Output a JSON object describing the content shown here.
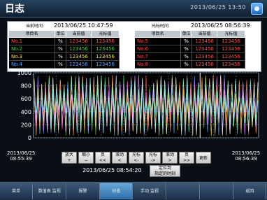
{
  "header": {
    "title": "日志",
    "clock": "2013/06/25  13:50"
  },
  "info": {
    "current_time_label": "当前时间:",
    "current_time_value": "2013/06/25 10:47:59",
    "cursor_time_label": "光标时间:",
    "cursor_time_value": "2013/06/25 08:56:39",
    "columns": [
      "项目名",
      "单位",
      "当前值",
      "光标值"
    ],
    "left_rows": [
      {
        "name": "No.1",
        "unit": "%",
        "current": "123456",
        "cursor": "123456",
        "color": "#ff4a4a"
      },
      {
        "name": "No.2",
        "unit": "%",
        "current": "123456",
        "cursor": "123456",
        "color": "#47d447"
      },
      {
        "name": "No.3",
        "unit": "%",
        "current": "123456",
        "cursor": "123456",
        "color": "#f2e23a"
      },
      {
        "name": "No.4",
        "unit": "%",
        "current": "123456",
        "cursor": "123456",
        "color": "#4aa6ff"
      }
    ],
    "right_rows": [
      {
        "name": "No.5",
        "unit": "%",
        "current": "123456",
        "cursor": "123456",
        "color": "#ff4a4a"
      },
      {
        "name": "No.6",
        "unit": "%",
        "current": "123456",
        "cursor": "123456",
        "color": "#ff4a4a"
      },
      {
        "name": "No.7",
        "unit": "%",
        "current": "123456",
        "cursor": "123456",
        "color": "#ff4a4a"
      },
      {
        "name": "No.8",
        "unit": "%",
        "current": "123456",
        "cursor": "123456",
        "color": "#ff4a4a"
      }
    ]
  },
  "chart_data": {
    "type": "line",
    "ylim": [
      0,
      1000
    ],
    "y_ticks": [
      "1000",
      "800",
      "600",
      "400",
      "200",
      "0"
    ],
    "series_colors": [
      "#ff4a4a",
      "#47d447",
      "#f2e23a",
      "#4aa6ff",
      "#ff8a3a",
      "#d86bff",
      "#e6e6e6",
      "#7dffd8"
    ]
  },
  "controls": {
    "date_left": "2013/06/25",
    "time_left": "08:55:39",
    "date_right": "2013/06/25",
    "time_right": "08:56:39",
    "cursor_time": "2013/06/25 08:54:20",
    "buttons": [
      {
        "label": "放大",
        "sym": "+"
      },
      {
        "label": "缩小",
        "sym": "−"
      },
      {
        "label": "页",
        "sym": "<<"
      },
      {
        "label": "滚动",
        "sym": "<"
      },
      {
        "label": "光标",
        "sym": "<-"
      },
      {
        "label": "光标",
        "sym": "->"
      },
      {
        "label": "滚动",
        "sym": ">"
      },
      {
        "label": "页",
        "sym": ">>"
      },
      {
        "label": "更新",
        "sym": ""
      }
    ],
    "locate_line1": "定位到",
    "locate_line2": "指定的时刻"
  },
  "footer": {
    "items": [
      {
        "label": "菜单",
        "active": false
      },
      {
        "label": "数值表 监视",
        "active": false
      },
      {
        "label": "报警",
        "active": false
      },
      {
        "label": "日志",
        "active": true
      },
      {
        "label": "手动 监视",
        "active": false
      },
      {
        "label": "",
        "active": false
      },
      {
        "label": "",
        "active": false
      },
      {
        "label": "返回",
        "active": false
      }
    ]
  }
}
